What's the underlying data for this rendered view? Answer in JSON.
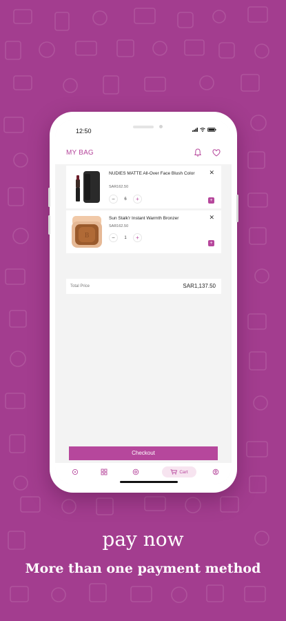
{
  "status_bar": {
    "time": "12:50"
  },
  "header": {
    "title": "MY BAG"
  },
  "cart": {
    "items": [
      {
        "name": "NUDIES MATTE All-Over Face Blush Color",
        "price": "SAR162.50",
        "quantity": "6"
      },
      {
        "name": "Sun Stalk'r Instant Warmth Bronzer",
        "price": "SAR162.50",
        "quantity": "1"
      }
    ],
    "total_label": "Total Price",
    "total_value": "SAR1,137.50",
    "checkout_label": "Checkout"
  },
  "bottom_nav": {
    "cart_label": "Cart"
  },
  "promo": {
    "headline": "pay now",
    "subline": "More than one payment method"
  },
  "colors": {
    "background": "#a33d8f",
    "accent": "#b6479c"
  }
}
